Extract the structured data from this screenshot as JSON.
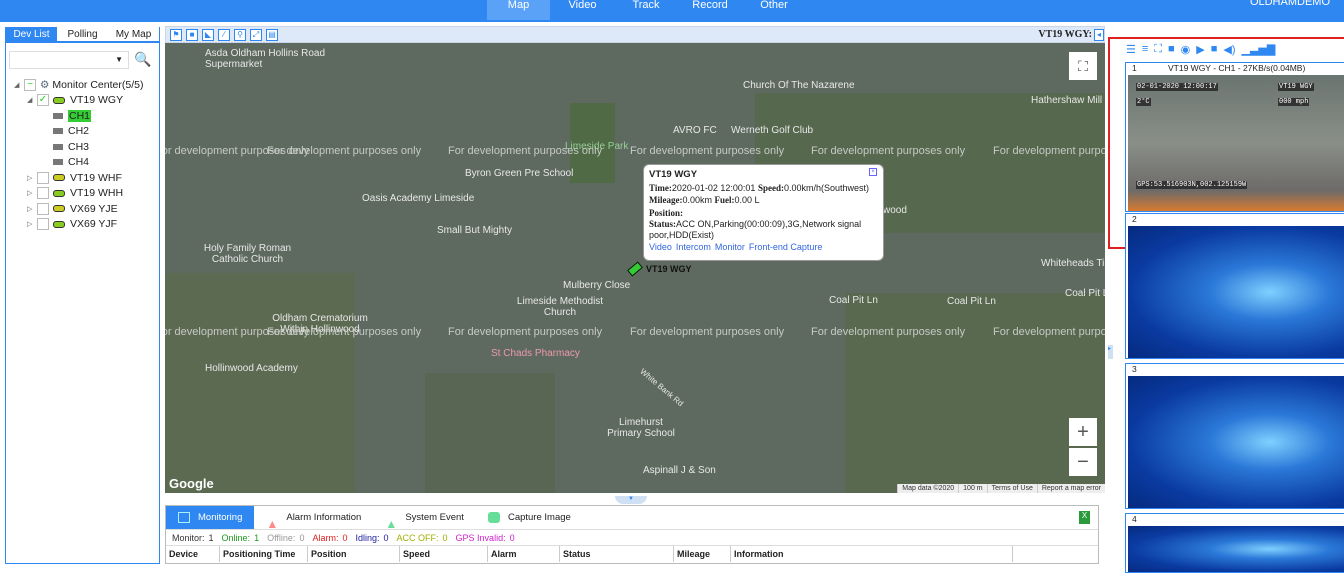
{
  "nav": {
    "items": [
      "Map",
      "Video",
      "Track",
      "Record",
      "Other"
    ],
    "active": "Map",
    "user": "OLDHAMDEMO"
  },
  "left": {
    "tabs": [
      "Dev List",
      "Polling",
      "My Map"
    ],
    "active": "Dev List",
    "tree": {
      "root": "Monitor Center(5/5)",
      "vehicles": [
        {
          "name": "VT19 WGY",
          "checked": true,
          "expanded": true,
          "channels": [
            "CH1",
            "CH2",
            "CH3",
            "CH4"
          ],
          "active_channel": "CH1"
        },
        {
          "name": "VT19 WHF",
          "checked": false
        },
        {
          "name": "VT19 WHH",
          "checked": false
        },
        {
          "name": "VX69 YJE",
          "checked": false
        },
        {
          "name": "VX69 YJF",
          "checked": false
        }
      ]
    }
  },
  "map_toolbar": {
    "icons": [
      "flag-icon",
      "rectangle-icon",
      "polygon-icon",
      "line-icon",
      "search-icon",
      "fit-icon",
      "save-icon"
    ],
    "vehicle": "VT19 WGY:"
  },
  "map": {
    "labels": [
      "Asda Oldham Hollins Road Supermarket",
      "Church Of The Nazarene",
      "AVRO FC",
      "Werneth Golf Club",
      "Hathershaw Mill",
      "Limeside Park",
      "Byron Green Pre School",
      "Oasis Academy Limeside",
      "Small But Mighty",
      "Holy Family Roman Catholic Church",
      "Mulberry Close",
      "Limeside Methodist Church",
      "Oldham Crematorium Within Hollinwood",
      "St Chads Pharmacy",
      "Hollinwood Academy",
      "Limehurst Primary School",
      "Aspinall J & Son",
      "Whiteheads Ti",
      "Coal Pit Ln",
      "Coal Pit Ln",
      "Coal Pit Ln",
      "White Bank Rd",
      "wood"
    ],
    "watermark": "For development purposes only",
    "vehicle_marker": "VT19 WGY",
    "popup": {
      "title": "VT19 WGY",
      "time_label": "Time:",
      "time": "2020-01-02 12:00:01",
      "speed_label": "Speed:",
      "speed": "0.00km/h(Southwest)",
      "mileage_label": "Mileage:",
      "mileage": "0.00km",
      "fuel_label": "Fuel:",
      "fuel": "0.00 L",
      "position_label": "Position:",
      "status_label": "Status:",
      "status": "ACC ON,Parking(00:00:09),3G,Network signal poor,HDD(Exist)",
      "links": [
        "Video",
        "Intercom",
        "Monitor",
        "Front-end Capture"
      ]
    },
    "zoom_in": "+",
    "zoom_out": "−",
    "attribution": [
      "Map data ©2020",
      "100 m",
      "Terms of Use",
      "Report a map error"
    ],
    "logo": "Google"
  },
  "bottom": {
    "tabs": [
      "Monitoring",
      "Alarm Information",
      "System Event",
      "Capture Image"
    ],
    "active": "Monitoring",
    "stats": [
      {
        "label": "Monitor:",
        "value": "1",
        "color": "#333333"
      },
      {
        "label": "Online:",
        "value": "1",
        "color": "#1a9a1a"
      },
      {
        "label": "Offline:",
        "value": "0",
        "color": "#999999"
      },
      {
        "label": "Alarm:",
        "value": "0",
        "color": "#e02020"
      },
      {
        "label": "Idling:",
        "value": "0",
        "color": "#2020a0"
      },
      {
        "label": "ACC OFF:",
        "value": "0",
        "color": "#a0b000"
      },
      {
        "label": "GPS Invalid:",
        "value": "0",
        "color": "#d020d0"
      }
    ],
    "columns": [
      "Device",
      "Positioning Time",
      "Position",
      "Speed",
      "Alarm",
      "Status",
      "Mileage",
      "Information",
      ""
    ]
  },
  "video": {
    "panels": [
      {
        "num": "1",
        "title": "VT19 WGY - CH1 - 27KB/s(0.04MB)",
        "osd": [
          "02-01-2020 12:00:17",
          "VT19 WGY",
          "2°C",
          "000 mph",
          "GPS:53.516903N,002.125159W"
        ]
      },
      {
        "num": "2"
      },
      {
        "num": "3"
      },
      {
        "num": "4"
      }
    ]
  },
  "colors": {
    "accent": "#2f87f2",
    "selection": "#e02020"
  }
}
